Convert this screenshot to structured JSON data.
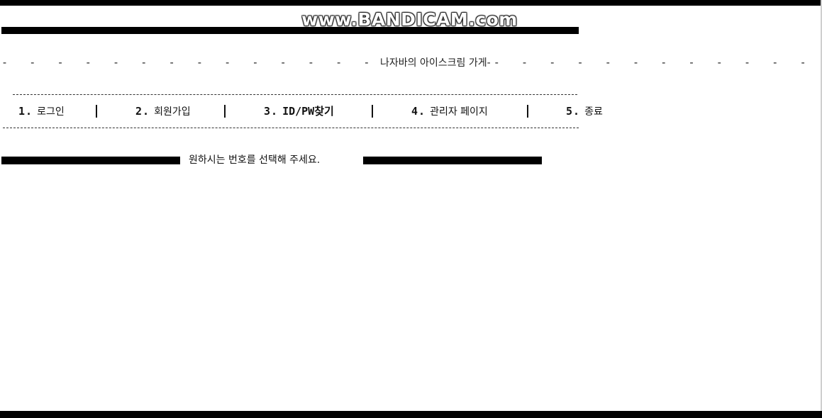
{
  "recording_watermark": "www.BANDICAM.com",
  "header": {
    "title": "나자바의 아이스크림 가게",
    "dash_prefix": "- - - - - - - - - - - - - -",
    "dash_suffix": "- - - - - - - - - - - -",
    "title_dash_before": "",
    "title_dash_after": "-"
  },
  "menu": {
    "items": [
      {
        "number": "1.",
        "label": "로그인"
      },
      {
        "number": "2.",
        "label": "회원가입"
      },
      {
        "number": "3.",
        "label": "ID/PW찾기"
      },
      {
        "number": "4.",
        "label": "관리자 페이지"
      },
      {
        "number": "5.",
        "label": "종료"
      }
    ],
    "separator": "|"
  },
  "prompt": {
    "text": "원하시는 번호를 선택해 주세요."
  }
}
